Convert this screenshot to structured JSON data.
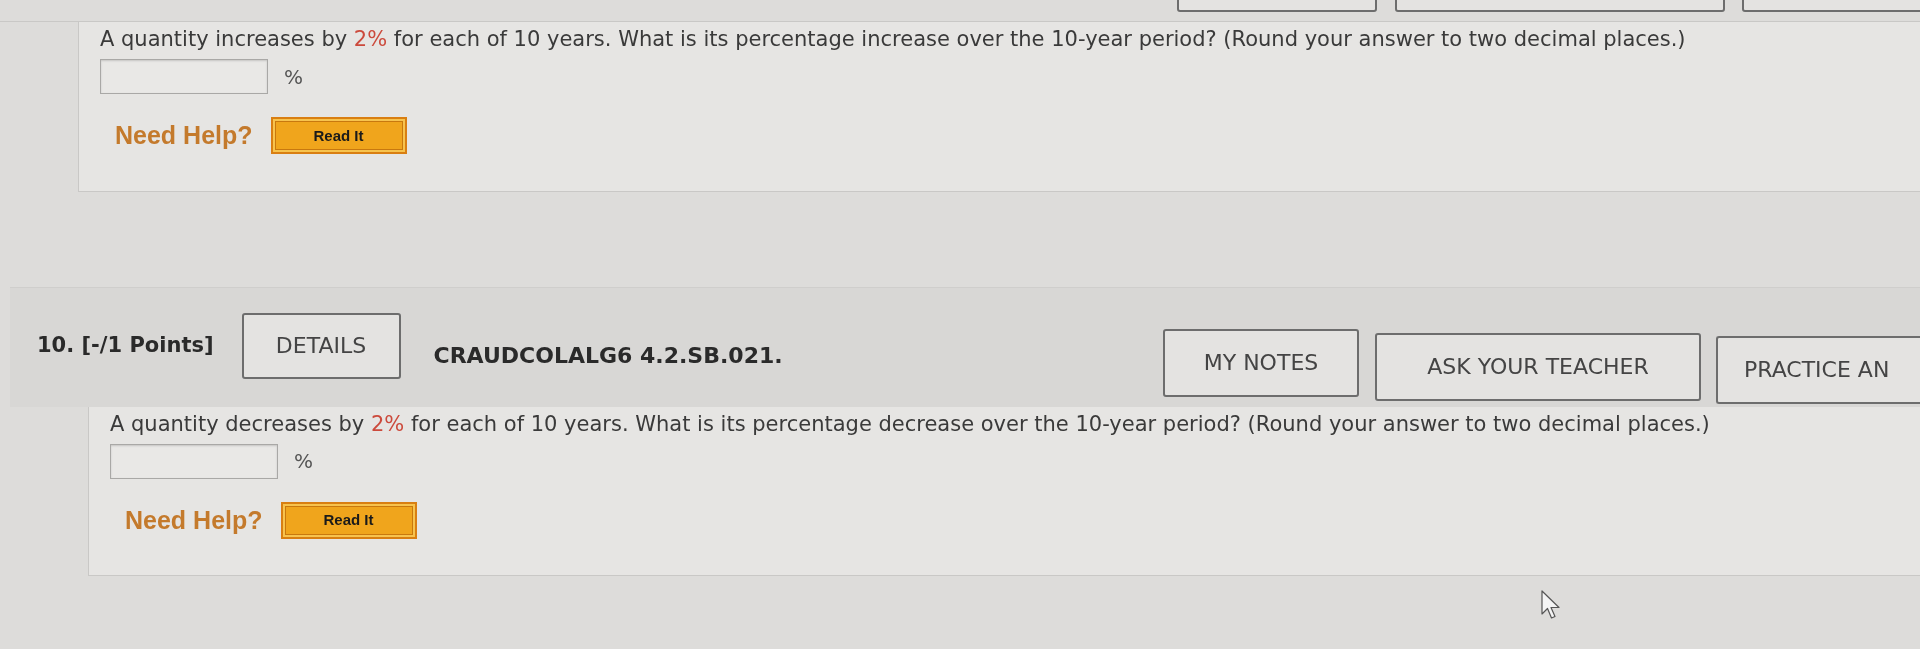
{
  "previous_question": {
    "prompt": [
      {
        "text": "A quantity increases by ",
        "highlighted": false
      },
      {
        "text": "2%",
        "highlighted": true
      },
      {
        "text": " for each of 10 years. What is its percentage increase over the 10-year period? (Round your answer to two decimal places.)",
        "highlighted": false
      }
    ],
    "answer_unit": "%",
    "help_label": "Need Help?",
    "help_buttons": [
      "Read It"
    ]
  },
  "question": {
    "number_points": "10. [-/1 Points]",
    "details_button": "DETAILS",
    "code": "CRAUDCOLALG6 4.2.SB.021.",
    "action_buttons": [
      "MY NOTES",
      "ASK YOUR TEACHER",
      "PRACTICE AN"
    ],
    "prompt": [
      {
        "text": "A quantity decreases by ",
        "highlighted": false
      },
      {
        "text": "2%",
        "highlighted": true
      },
      {
        "text": " for each of 10 years. What is its percentage decrease over the 10-year period? (Round your answer to two decimal places.)",
        "highlighted": false
      }
    ],
    "answer_unit": "%",
    "help_label": "Need Help?",
    "help_buttons": [
      "Read It"
    ]
  }
}
